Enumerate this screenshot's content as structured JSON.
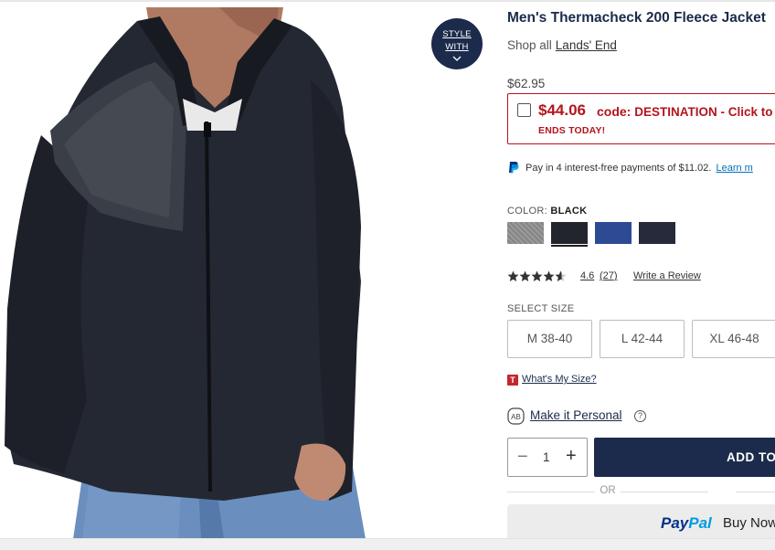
{
  "product": {
    "title": "Men's Thermacheck 200 Fleece Jacket",
    "shop_all_label": "Shop all",
    "brand_link": "Lands' End",
    "original_price": "$62.95",
    "style_with": {
      "line1": "STYLE",
      "line2": "WITH"
    }
  },
  "promo": {
    "sale_price": "$44.06",
    "code_prefix": "code:",
    "code_text": "DESTINATION - Click to",
    "ends_text": "ENDS TODAY!",
    "accent_color": "#b5141d"
  },
  "paypal_message": {
    "text": "Pay in 4 interest-free payments of $11.02.",
    "link": "Learn m"
  },
  "color": {
    "label": "COLOR:",
    "selected": "BLACK",
    "swatches": [
      {
        "name": "gray-heather",
        "hex": "#8c8c8c"
      },
      {
        "name": "black",
        "hex": "#23252d"
      },
      {
        "name": "blue",
        "hex": "#2e4a94"
      },
      {
        "name": "navy",
        "hex": "#262a3a"
      }
    ]
  },
  "rating": {
    "value": 4.6,
    "value_text": "4.6",
    "count_text": "(27)",
    "write_review": "Write a Review"
  },
  "size": {
    "label": "SELECT SIZE",
    "options": [
      "M 38-40",
      "L 42-44",
      "XL 46-48"
    ]
  },
  "whats_my_size": {
    "badge": "T",
    "link": "What's My Size?"
  },
  "personalize": {
    "icon_text": "AB",
    "link": "Make it Personal",
    "help": "?"
  },
  "quantity": {
    "value": "1",
    "minus": "−",
    "plus": "+"
  },
  "add_to_bag": "ADD TO",
  "or_text": "OR",
  "paypal_button": {
    "pay": "Pay",
    "pal": "Pal",
    "buy": "Buy Now"
  },
  "brand_color": "#1c2b4b"
}
